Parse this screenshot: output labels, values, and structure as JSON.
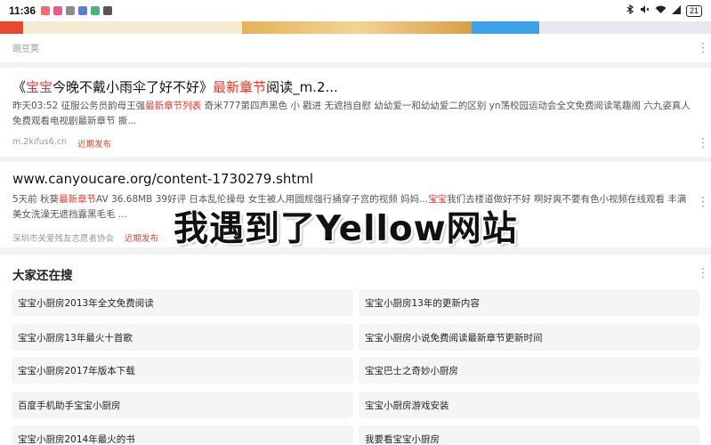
{
  "status_bar": {
    "time": "11:36",
    "battery": "21"
  },
  "result0": {
    "source": "豌豆荚"
  },
  "result1": {
    "title_prefix": "《",
    "title_hl1": "宝宝",
    "title_mid": "今晚不戴小雨伞了好不好》",
    "title_hl2": "最新章节",
    "title_suffix": "阅读_m.2...",
    "snippet_a": "昨天03:52  征服公务员韵母王强",
    "snippet_hl": "最新章节列表",
    "snippet_b": " 奇米777第四声黑色 小 戳进 无遮挡自慰 幼幼爱一和幼幼爱二的区别 yn荡校园运动会全文免费阅读笔趣阁 六九姿真人免费观看电视剧最新章节 撕...",
    "domain": "m.2kifus6.cn",
    "tag": "近期发布"
  },
  "result2": {
    "title": "www.canyoucare.org/content-1730279.shtml",
    "snippet_a": "5天前  秋葵",
    "snippet_hl1": "最新章节",
    "snippet_b": "AV 36.68MB 39好评 日本乱伦操母 女生被人用圆规强行捅穿子宫的视频 妈妈...",
    "snippet_hl2": "宝宝",
    "snippet_c": "我们去楼道做好不好 啊好爽不要有色小视频在线观看 丰满美女洗澡无遮挡露黑毛毛 ...",
    "domain": "深圳市关爱残友志愿者协会",
    "tag": "近期发布"
  },
  "related": {
    "title": "大家还在搜",
    "items": [
      "宝宝小厨房2013年全文免费阅读",
      "宝宝小厨房13年的更新内容",
      "宝宝小厨房13年最火十首歌",
      "宝宝小厨房小说免费阅读最新章节更新时间",
      "宝宝小厨房2017年版本下载",
      "宝宝巴士之奇妙小厨房",
      "百度手机助手宝宝小厨房",
      "宝宝小厨房游戏安装",
      "宝宝小厨房2014年最火的书",
      "我要看宝宝小厨房"
    ]
  },
  "overlay_caption": "我遇到了Yellow网站",
  "icons": [
    "wifi-icon",
    "bluetooth-icon",
    "signal-icon",
    "more-icon"
  ],
  "colors": {
    "highlight": "#e33a2f",
    "tag": "#d9452f"
  }
}
